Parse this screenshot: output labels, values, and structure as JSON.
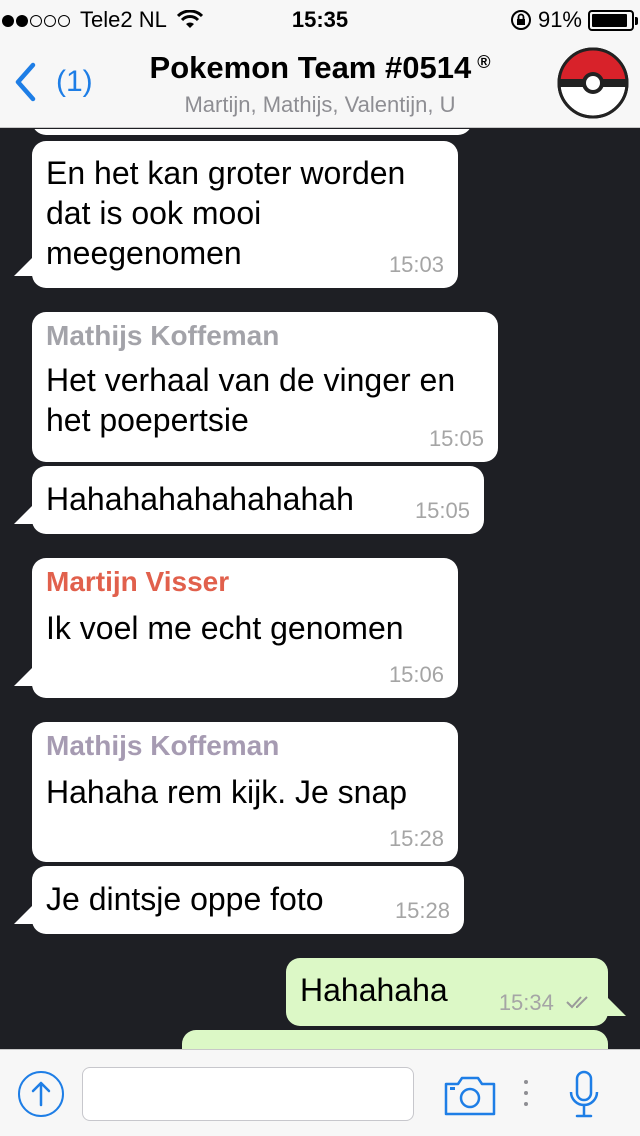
{
  "status": {
    "carrier": "Tele2 NL",
    "time": "15:35",
    "battery": "91%",
    "battery_level": 0.91,
    "signal_bars_filled": 2,
    "signal_bars_total": 5
  },
  "header": {
    "back_count": "(1)",
    "title": "Pokemon Team #0514",
    "title_mark": "®",
    "subtitle": "Martijn, Mathijs, Valentijn, U"
  },
  "messages": [
    {
      "direction": "in",
      "text_lines": [
        "En het kan groter worden",
        "dat is ook mooi",
        "meegenomen"
      ],
      "time": "15:03"
    },
    {
      "direction": "in",
      "sender": "Mathijs Koffeman",
      "sender_color": "#a3a3a9",
      "text_lines": [
        "Het verhaal van de vinger en",
        "het poepertsie"
      ],
      "time": "15:05"
    },
    {
      "direction": "in",
      "text_lines": [
        "Hahahahahahahahah"
      ],
      "time": "15:05"
    },
    {
      "direction": "in",
      "sender": "Martijn Visser",
      "sender_color": "#e1604c",
      "text_lines": [
        "Ik voel me echt genomen"
      ],
      "time": "15:06"
    },
    {
      "direction": "in",
      "sender": "Mathijs Koffeman",
      "sender_color": "#a69bb2",
      "text_lines": [
        "Hahaha rem kijk. Je snap"
      ],
      "time": "15:28"
    },
    {
      "direction": "in",
      "text_lines": [
        "Je dintsje oppe foto"
      ],
      "time": "15:28"
    },
    {
      "direction": "out",
      "text_lines": [
        "Hahahaha"
      ],
      "time": "15:34",
      "status_icon": "double-check-icon"
    }
  ],
  "input": {
    "value": "",
    "placeholder": ""
  },
  "icons": {
    "back": "chevron-left-icon",
    "avatar": "pokeball-icon",
    "attach": "upload-arrow-icon",
    "camera": "camera-icon",
    "mic": "microphone-icon"
  },
  "colors": {
    "accent": "#1e7ee6",
    "chat_background": "#1e1f24",
    "incoming_bubble": "#ffffff",
    "outgoing_bubble": "#dcf8c6"
  }
}
